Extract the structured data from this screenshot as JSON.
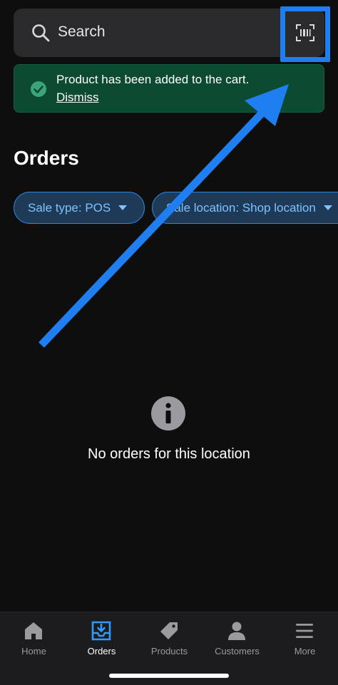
{
  "search": {
    "label": "Search"
  },
  "toast": {
    "message": "Product has been added to the cart.",
    "dismiss": "Dismiss"
  },
  "page": {
    "title": "Orders"
  },
  "filters": [
    {
      "label": "Sale type: POS"
    },
    {
      "label": "Sale location: Shop location"
    }
  ],
  "empty_state": {
    "message": "No orders for this location"
  },
  "bottom_nav": {
    "items": [
      {
        "label": "Home",
        "icon": "home-icon",
        "active": false
      },
      {
        "label": "Orders",
        "icon": "orders-icon",
        "active": true
      },
      {
        "label": "Products",
        "icon": "tag-icon",
        "active": false
      },
      {
        "label": "Customers",
        "icon": "person-icon",
        "active": false
      },
      {
        "label": "More",
        "icon": "menu-icon",
        "active": false
      }
    ]
  },
  "colors": {
    "accent": "#1f7ff0",
    "success_bg": "#0c4a32",
    "chip_text": "#7cc3ff",
    "active_nav_icon": "#2f9bff"
  }
}
